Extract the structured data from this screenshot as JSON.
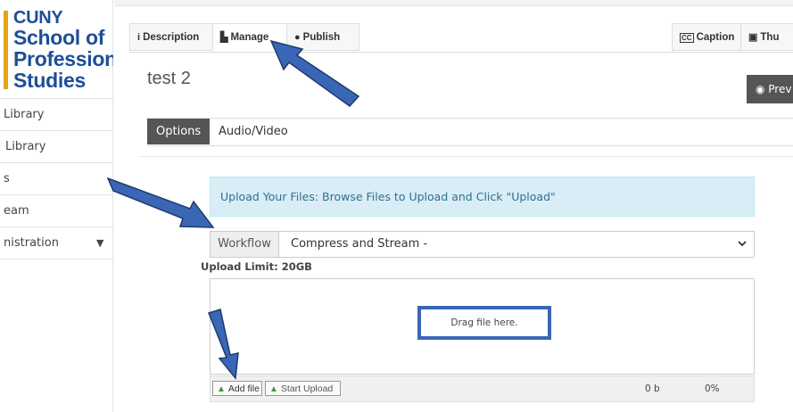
{
  "sidebar": {
    "logo": {
      "line1": "CUNY",
      "line2": "School of",
      "line3": "Professional",
      "line4": "Studies"
    },
    "items": [
      {
        "label": "Library"
      },
      {
        "label": "Library"
      },
      {
        "label": "s"
      },
      {
        "label": "eam"
      },
      {
        "label": "nistration",
        "caret": "▼"
      }
    ]
  },
  "tabs": {
    "description": {
      "icon": "i",
      "label": "Description"
    },
    "manage": {
      "icon": "▙",
      "label": "Manage"
    },
    "publish": {
      "icon": "●",
      "label": "Publish"
    },
    "caption": {
      "icon": "CC",
      "label": "Caption"
    },
    "thumbnail": {
      "icon": "▣",
      "label": "Thu"
    }
  },
  "page": {
    "title": "test 2",
    "preview_button": "◉ Prev"
  },
  "subtabs": {
    "options": "Options",
    "audio_video": "Audio/Video"
  },
  "upload": {
    "alert": "Upload Your Files: Browse Files to Upload and Click \"Upload\"",
    "workflow_label": "Workflow",
    "workflow_value": "Compress and Stream -",
    "limit": "Upload Limit: 20GB",
    "drag_text": "Drag file here.",
    "add_file": "Add file",
    "start_upload": "Start Upload",
    "size": "0 b",
    "percent": "0%"
  },
  "colors": {
    "annotation_arrow": "#3a67b5",
    "logo_blue": "#1d4e9a",
    "logo_gold": "#e8a317",
    "alert_bg": "#d9edf7"
  },
  "icons": {
    "upload_arrow": "▲",
    "chevron": "⌄"
  }
}
